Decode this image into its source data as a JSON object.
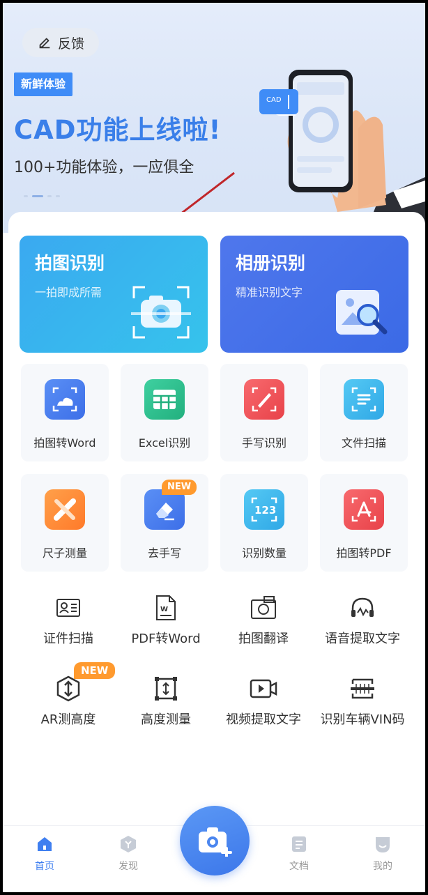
{
  "banner": {
    "feedback_label": "反馈",
    "tag": "新鲜体验",
    "headline": "CAD功能上线啦!",
    "subline": "100+功能体验，一应俱全",
    "phone_badge": "CAD",
    "slide_total": 4,
    "slide_active": 2
  },
  "main_cards": [
    {
      "title": "拍图识别",
      "subtitle": "一拍即成所需"
    },
    {
      "title": "相册识别",
      "subtitle": "精准识别文字"
    }
  ],
  "feature_tiles": [
    {
      "label": "拍图转Word",
      "icon": "photo-to-word-icon",
      "color": "#4a7ff0"
    },
    {
      "label": "Excel识别",
      "icon": "excel-icon",
      "color": "#2fbf8f"
    },
    {
      "label": "手写识别",
      "icon": "handwriting-icon",
      "color": "#f0565a"
    },
    {
      "label": "文件扫描",
      "icon": "file-scan-icon",
      "color": "#3fb7ec"
    },
    {
      "label": "尺子测量",
      "icon": "ruler-icon",
      "color": "#ff8a3d"
    },
    {
      "label": "去手写",
      "icon": "eraser-icon",
      "color": "#4a7ff0",
      "badge": "NEW"
    },
    {
      "label": "识别数量",
      "icon": "count-123-icon",
      "color": "#3fb7ec"
    },
    {
      "label": "拍图转PDF",
      "icon": "pdf-icon",
      "color": "#f0565a"
    }
  ],
  "tools": [
    {
      "label": "证件扫描",
      "icon": "id-card-icon"
    },
    {
      "label": "PDF转Word",
      "icon": "pdf-to-word-icon"
    },
    {
      "label": "拍图翻译",
      "icon": "photo-translate-icon"
    },
    {
      "label": "语音提取文字",
      "icon": "headset-icon"
    },
    {
      "label": "AR测高度",
      "icon": "ar-height-icon",
      "badge": "NEW"
    },
    {
      "label": "高度测量",
      "icon": "height-measure-icon"
    },
    {
      "label": "视频提取文字",
      "icon": "video-icon"
    },
    {
      "label": "识别车辆VIN码",
      "icon": "vin-icon"
    }
  ],
  "nav": {
    "home": "首页",
    "discover": "发现",
    "docs": "文档",
    "mine": "我的"
  },
  "colors": {
    "accent": "#3f7ff0",
    "headline": "#3a7fe9",
    "new_badge": "#ff9a2e"
  }
}
